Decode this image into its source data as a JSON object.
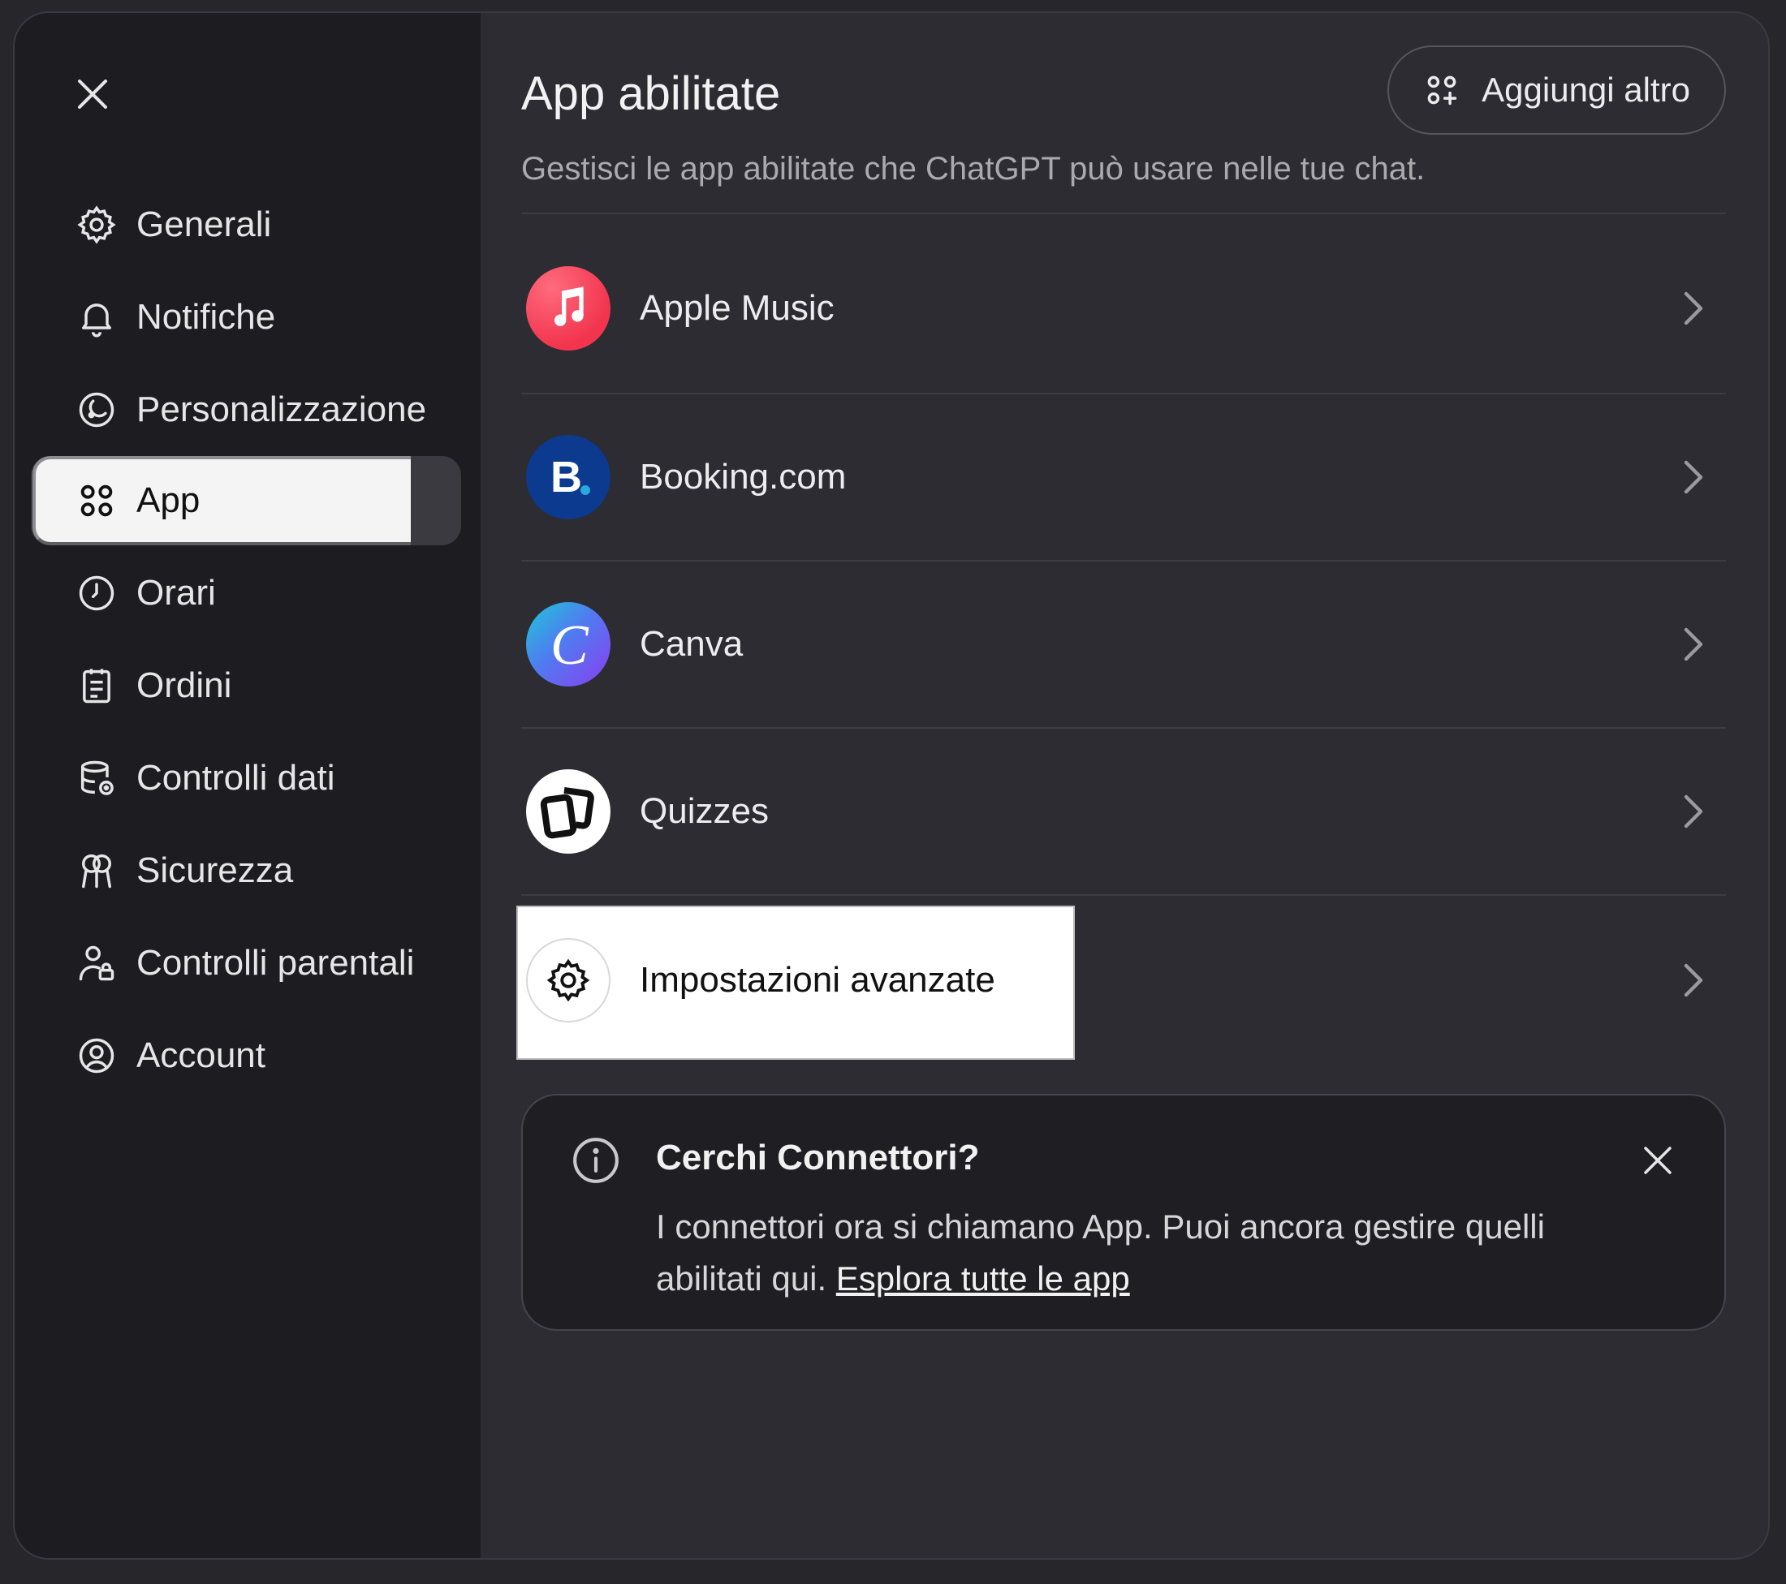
{
  "sidebar": {
    "items": [
      {
        "label": "Generali",
        "icon": "gear-icon"
      },
      {
        "label": "Notifiche",
        "icon": "bell-icon"
      },
      {
        "label": "Personalizzazione",
        "icon": "personalization-icon"
      },
      {
        "label": "App",
        "icon": "apps-grid-icon",
        "active": true
      },
      {
        "label": "Orari",
        "icon": "clock-icon"
      },
      {
        "label": "Ordini",
        "icon": "orders-icon"
      },
      {
        "label": "Controlli dati",
        "icon": "database-icon"
      },
      {
        "label": "Sicurezza",
        "icon": "security-icon"
      },
      {
        "label": "Controlli parentali",
        "icon": "parental-icon"
      },
      {
        "label": "Account",
        "icon": "account-icon"
      }
    ]
  },
  "main": {
    "title": "App abilitate",
    "subtitle": "Gestisci le app abilitate che ChatGPT può usare nelle tue chat.",
    "add_button": "Aggiungi altro",
    "apps": [
      {
        "name": "Apple Music",
        "icon": "apple-music-icon",
        "color": "#f5425b"
      },
      {
        "name": "Booking.com",
        "icon": "booking-icon",
        "color": "#0b3a8f"
      },
      {
        "name": "Canva",
        "icon": "canva-icon",
        "color": "#7c3aed"
      },
      {
        "name": "Quizzes",
        "icon": "quizzes-icon",
        "color": "#ffffff"
      }
    ],
    "advanced": {
      "label": "Impostazioni avanzate",
      "icon": "gear-icon"
    }
  },
  "info_card": {
    "title": "Cerchi Connettori?",
    "body": "I connettori ora si chiamano App. Puoi ancora gestire quelli abilitati qui.",
    "link": "Esplora tutte le app"
  }
}
